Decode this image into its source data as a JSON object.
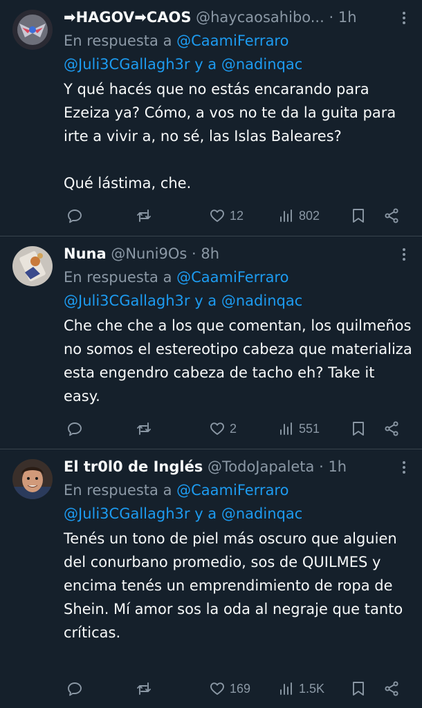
{
  "tweets": [
    {
      "display_name": "➡HAGOV➡CAOS",
      "handle": "@haycaosahibo...",
      "time": "· 1h",
      "reply_prefix": "En respuesta a",
      "reply_mention1": "@CaamiFerraro",
      "reply_mention2": "@Juli3CGallagh3r",
      "reply_and": "y a",
      "reply_mention3": "@nadinqac",
      "text": "Y qué hacés que no estás encarando para Ezeiza ya? Cómo, a vos no te da la guita para irte a vivir a, no sé, las Islas Baleares?\n\nQué lástima, che.",
      "likes": "12",
      "views": "802"
    },
    {
      "display_name": "Nuna",
      "handle": "@Nuni9Os",
      "time": "· 8h",
      "reply_prefix": "En respuesta a",
      "reply_mention1": "@CaamiFerraro",
      "reply_mention2": "@Juli3CGallagh3r",
      "reply_and": "y a",
      "reply_mention3": "@nadinqac",
      "text": "Che che che a los que comentan, los quilmeños no somos el estereotipo cabeza que materializa esta engendro cabeza de tacho eh? Take it easy.",
      "likes": "2",
      "views": "551"
    },
    {
      "display_name": "El tr0l0 de Inglés",
      "handle": "@TodoJapaleta",
      "time": "· 1h",
      "reply_prefix": "En respuesta a",
      "reply_mention1": "@CaamiFerraro",
      "reply_mention2": "@Juli3CGallagh3r",
      "reply_and": "y a",
      "reply_mention3": "@nadinqac",
      "text": "Tenés un tono de piel más oscuro que alguien del conurbano promedio, sos de QUILMES y encima tenés un emprendimiento de ropa de Shein. Mí amor sos la oda al negraje que tanto críticas.",
      "likes": "169",
      "views": "1.5K"
    }
  ],
  "icons": {
    "reply": "reply-icon",
    "retweet": "retweet-icon",
    "like": "heart-icon",
    "views": "views-icon",
    "bookmark": "bookmark-icon",
    "share": "share-icon",
    "more": "more-icon"
  },
  "colors": {
    "background": "#15202b",
    "text": "#f7f9f9",
    "secondary": "#8b98a5",
    "mention": "#1d9bf0",
    "divider": "#38444d"
  }
}
